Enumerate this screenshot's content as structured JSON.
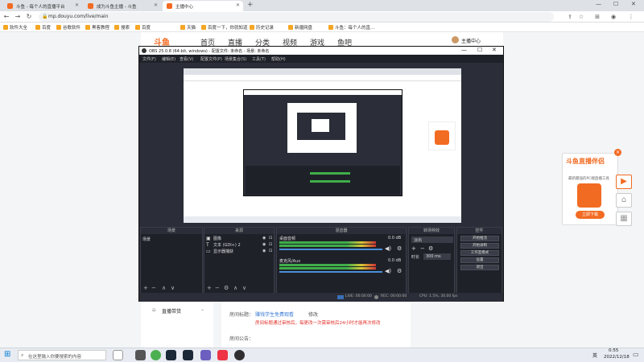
{
  "tabs": [
    {
      "label": "斗鱼 - 每个人的直播平台",
      "active": false
    },
    {
      "label": "成为斗鱼主播 - 斗鱼",
      "active": false
    },
    {
      "label": "主播中心",
      "active": true
    }
  ],
  "address": {
    "url": "mp.douyu.com/live/main"
  },
  "bookmarks": [
    "软件大全",
    "百度",
    "谷歌软件",
    "黑客教程",
    "搜索",
    "百度",
    "天猫",
    "百度一下，你就知道",
    "历史记录",
    "新疆网盘",
    "斗鱼：每个人的直..."
  ],
  "douyu": {
    "logo": "斗鱼",
    "nav": [
      "首页",
      "直播",
      "分类",
      "视频",
      "游戏",
      "鱼吧"
    ],
    "user": "主播中心"
  },
  "obs": {
    "title": "OBS 25.0.8 (64-bit, windows) - 配置文件: 未命名 - 场景: 未命名",
    "menu": [
      "文件(F)",
      "编辑(E)",
      "查看(V)",
      "配置文件(P)",
      "场景集合(S)",
      "工具(T)",
      "帮助(H)"
    ],
    "panels": {
      "scenes": {
        "title": "场景",
        "items": [
          "场景"
        ]
      },
      "sources": {
        "title": "来源",
        "items": [
          "图像",
          "文本 (GDI+) 2",
          "显示器捕获"
        ]
      },
      "mixer": {
        "title": "混音器",
        "channels": [
          {
            "name": "桌面音频",
            "db": "0.0 dB"
          },
          {
            "name": "麦克风/Aux",
            "db": "0.0 dB"
          }
        ]
      },
      "transitions": {
        "title": "转场特效",
        "type": "淡出",
        "duration_label": "时长",
        "duration": "300 ms"
      },
      "controls": {
        "title": "控件",
        "buttons": [
          "开始推流",
          "开始录制",
          "工作室模式",
          "设置",
          "退出"
        ]
      }
    },
    "status": {
      "live": "LIVE: 00:00:00",
      "rec": "REC: 00:00:00",
      "cpu": "CPU: 1.5%, 30.00 fps"
    }
  },
  "promo": {
    "title": "斗鱼直播伴侣",
    "desc": "最新最强的PC端直播工具",
    "button": "立即下载"
  },
  "lower": {
    "menu": "直播带货",
    "row1_label": "房间标题：",
    "row1_value": "赚钱学生免费观看",
    "row1_action": "修改",
    "warning": "房间标题通过审核后，每更改一次需审核后24小时才能再次修改",
    "row2_label": "房间公告："
  },
  "taskbar": {
    "search": "在这里输入你要搜索的内容",
    "time": "0:55",
    "date": "2022/12/18",
    "lang": "英"
  },
  "colors": {
    "accent": "#f26b22",
    "obs_bg": "#2b2e38"
  }
}
